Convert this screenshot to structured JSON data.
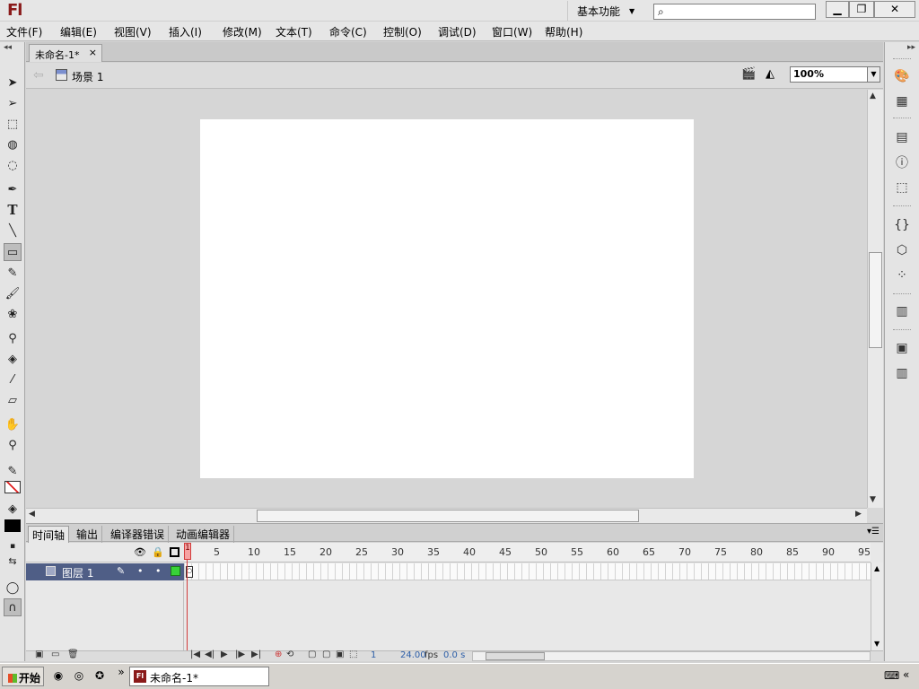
{
  "app": {
    "logo": "Fl",
    "workspace": "基本功能"
  },
  "search": {
    "placeholder": "",
    "icon": "search-icon"
  },
  "window_controls": [
    "minimize",
    "restore",
    "close"
  ],
  "menu": [
    "文件(F)",
    "编辑(E)",
    "视图(V)",
    "插入(I)",
    "修改(M)",
    "文本(T)",
    "命令(C)",
    "控制(O)",
    "调试(D)",
    "窗口(W)",
    "帮助(H)"
  ],
  "document": {
    "tab_title": "未命名-1*",
    "scene": "场景 1",
    "zoom": "100%"
  },
  "tools": [
    "selection-tool",
    "subselection-tool",
    "free-transform-tool",
    "3d-rotation-tool",
    "lasso-tool",
    "pen-tool",
    "text-tool",
    "line-tool",
    "rectangle-tool",
    "pencil-tool",
    "brush-tool",
    "deco-tool",
    "bone-tool",
    "paint-bucket-tool",
    "eyedropper-tool",
    "eraser-tool",
    "hand-tool",
    "zoom-tool",
    "stroke-color",
    "fill-color",
    "swap-colors",
    "object-drawing",
    "snap-to-objects"
  ],
  "panel_tabs": [
    "时间轴",
    "输出",
    "编译器错误",
    "动画编辑器"
  ],
  "timeline": {
    "ruler_ticks": [
      "1",
      "5",
      "10",
      "15",
      "20",
      "25",
      "30",
      "35",
      "40",
      "45",
      "50",
      "55",
      "60",
      "65",
      "70",
      "75",
      "80",
      "85",
      "90",
      "95"
    ],
    "layer_name": "图层 1",
    "current_frame": "1",
    "fps": "24.00",
    "fps_unit": "fps",
    "elapsed": "0.0 s"
  },
  "right_panels": [
    "color-icon",
    "swatches-icon",
    "align-icon",
    "info-icon",
    "transform-icon",
    "code-snippets-icon",
    "components-icon",
    "motion-presets-icon",
    "project-icon",
    "library-icon",
    "common-libraries-icon"
  ],
  "taskbar": {
    "start": "开始",
    "task": "未命名-1*",
    "more": "»",
    "tray_more": "«"
  }
}
